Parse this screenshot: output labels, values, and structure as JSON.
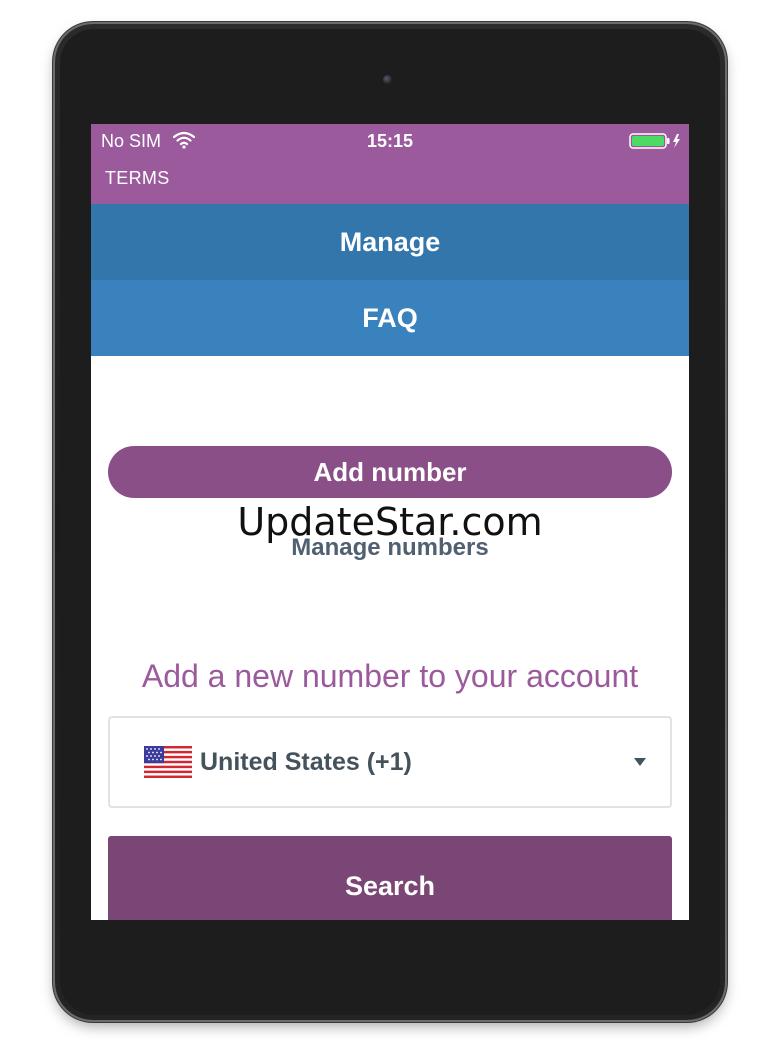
{
  "status_bar": {
    "carrier": "No SIM",
    "time": "15:15",
    "wifi_icon": "wifi-icon",
    "battery_icon": "battery-charging-icon",
    "battery_color": "#4cd964"
  },
  "nav": {
    "terms_label": "TERMS"
  },
  "menu": {
    "manage_label": "Manage",
    "faq_label": "FAQ"
  },
  "main": {
    "add_number_label": "Add number",
    "manage_numbers_label": "Manage numbers",
    "heading": "Add a new number to your account",
    "country_select": {
      "selected": "United States (+1)",
      "flag_icon": "us-flag-icon"
    },
    "search_label": "Search"
  },
  "watermark": "UpdateStar.com",
  "colors": {
    "header_purple": "#9b5a9c",
    "menu_blue_dark": "#3376ab",
    "menu_blue_light": "#3a82bd",
    "button_purple": "#8a4f87",
    "search_purple": "#7a4675"
  }
}
